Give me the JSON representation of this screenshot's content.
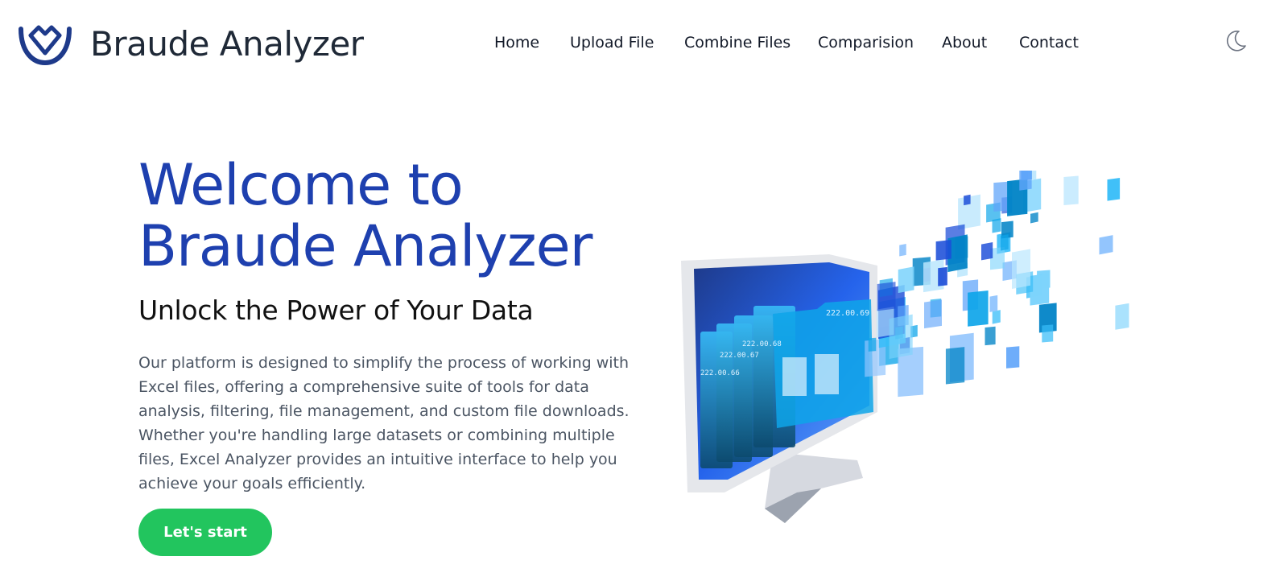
{
  "header": {
    "brand": "Braude Analyzer",
    "logo_icon": "tulip-logo-icon",
    "nav": [
      {
        "label": "Home"
      },
      {
        "label": "Upload File"
      },
      {
        "label": "Combine Files"
      },
      {
        "label": "Comparision"
      },
      {
        "label": "About"
      },
      {
        "label": "Contact"
      }
    ],
    "theme_toggle_icon": "moon-icon"
  },
  "hero": {
    "title_line1": "Welcome to",
    "title_line2": "Braude Analyzer",
    "subtitle": "Unlock the Power of Your Data",
    "description": "Our platform is designed to simplify the process of working with Excel files, offering a comprehensive suite of tools for data analysis, filtering, file management, and custom file downloads. Whether you're handling large datasets or combining multiple files, Excel Analyzer provides an intuitive interface to help you achieve your goals efficiently.",
    "cta_label": "Let's start",
    "illustration": "monitor-data-files-illustration",
    "folder_labels": [
      "222.00.69",
      "222.00.68",
      "222.00.67",
      "222.00.66"
    ]
  },
  "colors": {
    "accent": "#1e40af",
    "button": "#22c55e",
    "brand_text": "#1f2937",
    "logo": "#1e3a8a"
  }
}
